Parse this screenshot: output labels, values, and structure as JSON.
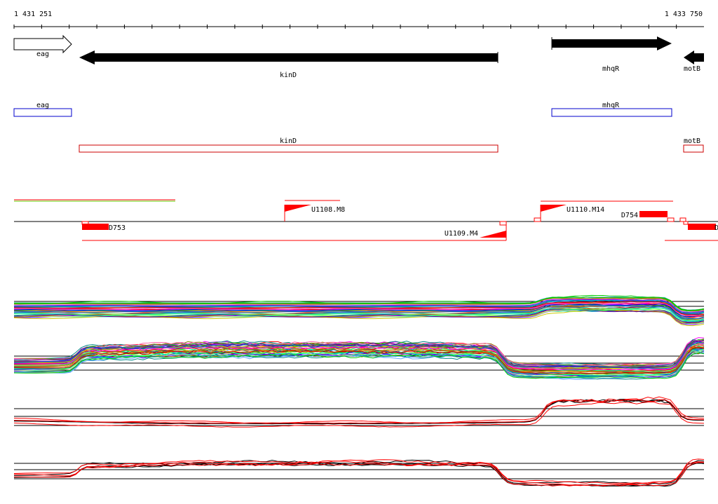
{
  "ruler": {
    "start_label": "1 431 251",
    "end_label": "1 433 750"
  },
  "genes": [
    {
      "name": "eag",
      "strand": "+",
      "style": "outline"
    },
    {
      "name": "kinD",
      "strand": "-",
      "style": "filled"
    },
    {
      "name": "mhqR",
      "strand": "+",
      "style": "filled"
    },
    {
      "name": "motB",
      "strand": "-",
      "style": "filled"
    }
  ],
  "annotations": [
    {
      "name": "eag",
      "color": "#0000cc"
    },
    {
      "name": "mhqR",
      "color": "#0000cc"
    },
    {
      "name": "kinD",
      "color": "#cc0000"
    },
    {
      "name": "motB",
      "color": "#cc0000"
    }
  ],
  "features": {
    "upstream": [
      "U1108.M8",
      "U1110.M14",
      "U1109.M4"
    ],
    "downstream": [
      "D753",
      "D754",
      "D"
    ]
  },
  "colors": {
    "arrow": "#000000",
    "feature": "#ff0000",
    "forward_box": "#0000cc",
    "reverse_box": "#cc0000"
  }
}
